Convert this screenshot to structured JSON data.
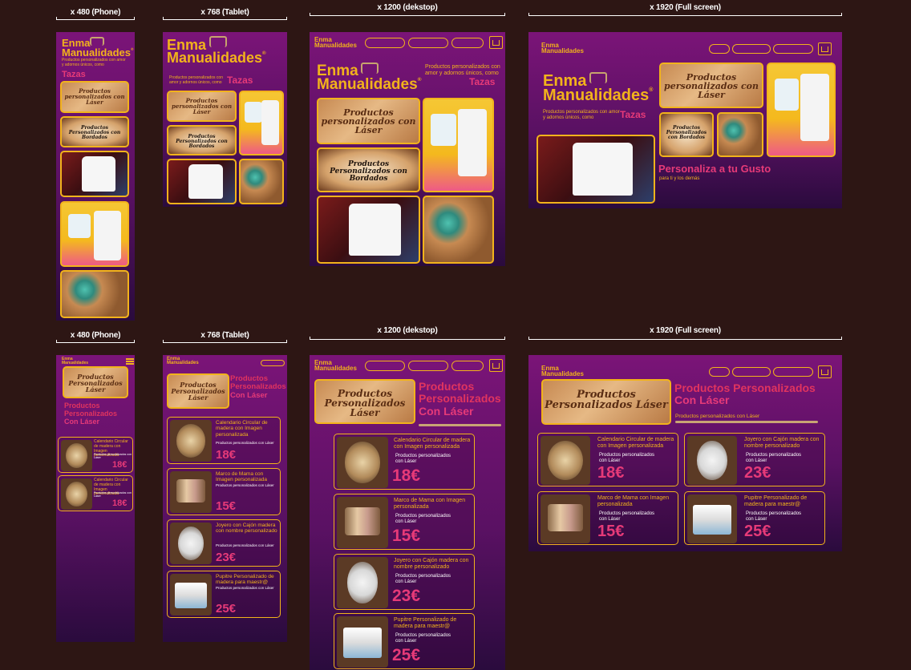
{
  "labels": {
    "phone": "x 480 (Phone)",
    "tablet": "x 768 (Tablet)",
    "desktop": "x 1200 (dekstop)",
    "full": "x 1920 (Full screen)"
  },
  "brand": {
    "line1": "Enma",
    "line2": "Manualidades",
    "reg": "®"
  },
  "home": {
    "tagline": "Productos personalizados con amor y adornos únicos, como",
    "rotating_word": "Tazas",
    "extra_title": "Personaliza a tu Gusto",
    "extra_subtitle": "para ti y los demás"
  },
  "photos": {
    "wood_text": "Productos personalizados con Láser",
    "plaque_text": "Productos Personalizados con Bordados"
  },
  "laser": {
    "title_1": "Productos",
    "title_2": "Personalizados",
    "title_3": "Con Láser",
    "subtitle": "Productos personalizados con Láser",
    "banner_text": "Productos Personalizados Láser"
  },
  "products": [
    {
      "name": "Calendario Circular de madera con Imagen personalizada",
      "desc": "Productos personalizados con Láser",
      "price": "18€"
    },
    {
      "name": "Marco de Mama con Imagen personalizada",
      "desc": "Productos personalizados con Láser",
      "price": "15€"
    },
    {
      "name": "Joyero con Cajón madera con nombre personalizado",
      "desc": "Productos personalizados con Láser",
      "price": "23€"
    },
    {
      "name": "Pupitre Personalizado de madera para maestr@",
      "desc": "Productos personalizados con Láser",
      "price": "25€"
    }
  ],
  "colors": {
    "background": "#2d1614",
    "gold": "#f2b31b",
    "pink": "#e63a78",
    "purple_top": "#7b1478",
    "purple_bottom": "#2a0b3d"
  },
  "icons": [
    "cart-icon",
    "menu-icon",
    "sewing-machine-icon"
  ]
}
